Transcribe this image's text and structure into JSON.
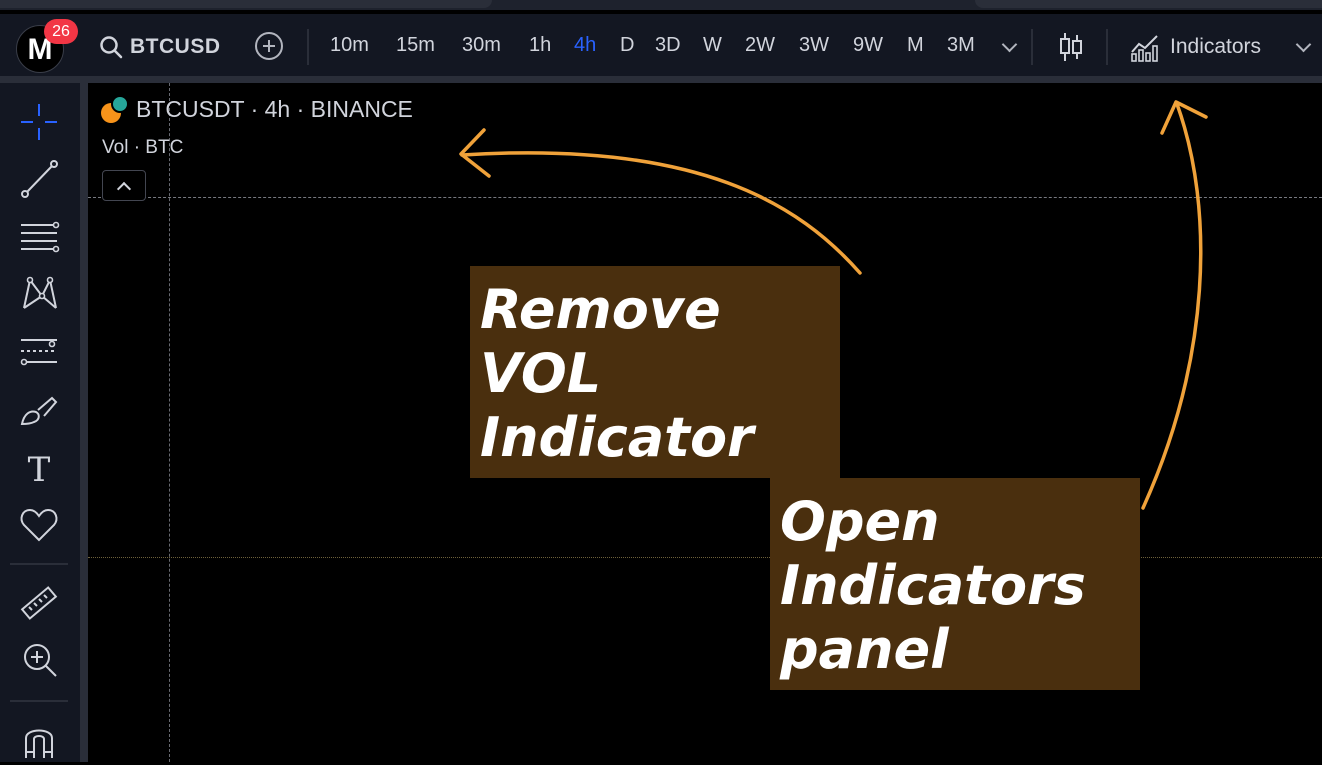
{
  "topbar": {
    "logo_letter": "M",
    "notification_count": "26",
    "symbol": "BTCUSD",
    "intervals": [
      {
        "label": "10m",
        "active": false
      },
      {
        "label": "15m",
        "active": false
      },
      {
        "label": "30m",
        "active": false
      },
      {
        "label": "1h",
        "active": false
      },
      {
        "label": "4h",
        "active": true
      },
      {
        "label": "D",
        "active": false
      },
      {
        "label": "3D",
        "active": false
      },
      {
        "label": "W",
        "active": false
      },
      {
        "label": "2W",
        "active": false
      },
      {
        "label": "3W",
        "active": false
      },
      {
        "label": "9W",
        "active": false
      },
      {
        "label": "M",
        "active": false
      },
      {
        "label": "3M",
        "active": false
      }
    ],
    "indicators_label": "Indicators"
  },
  "left_toolbar": {
    "tools": [
      "crosshair-icon",
      "trend-line-icon",
      "fib-lines-icon",
      "pattern-icon",
      "forecast-icon",
      "brush-icon",
      "text-icon",
      "heart-icon",
      "ruler-icon",
      "zoom-in-icon",
      "magnet-icon"
    ],
    "text_tool_glyph": "T"
  },
  "chart": {
    "title": "BTCUSDT · 4h · BINANCE",
    "volume_legend": "Vol · BTC"
  },
  "annotations": {
    "note1": [
      "Remove",
      "VOL",
      "Indicator"
    ],
    "note2": [
      "Open",
      "Indicators",
      "panel"
    ]
  },
  "colors": {
    "accent": "#2962ff",
    "badge": "#f23645",
    "note_bg": "#4a2f0e",
    "arrow": "#f0a23a"
  }
}
